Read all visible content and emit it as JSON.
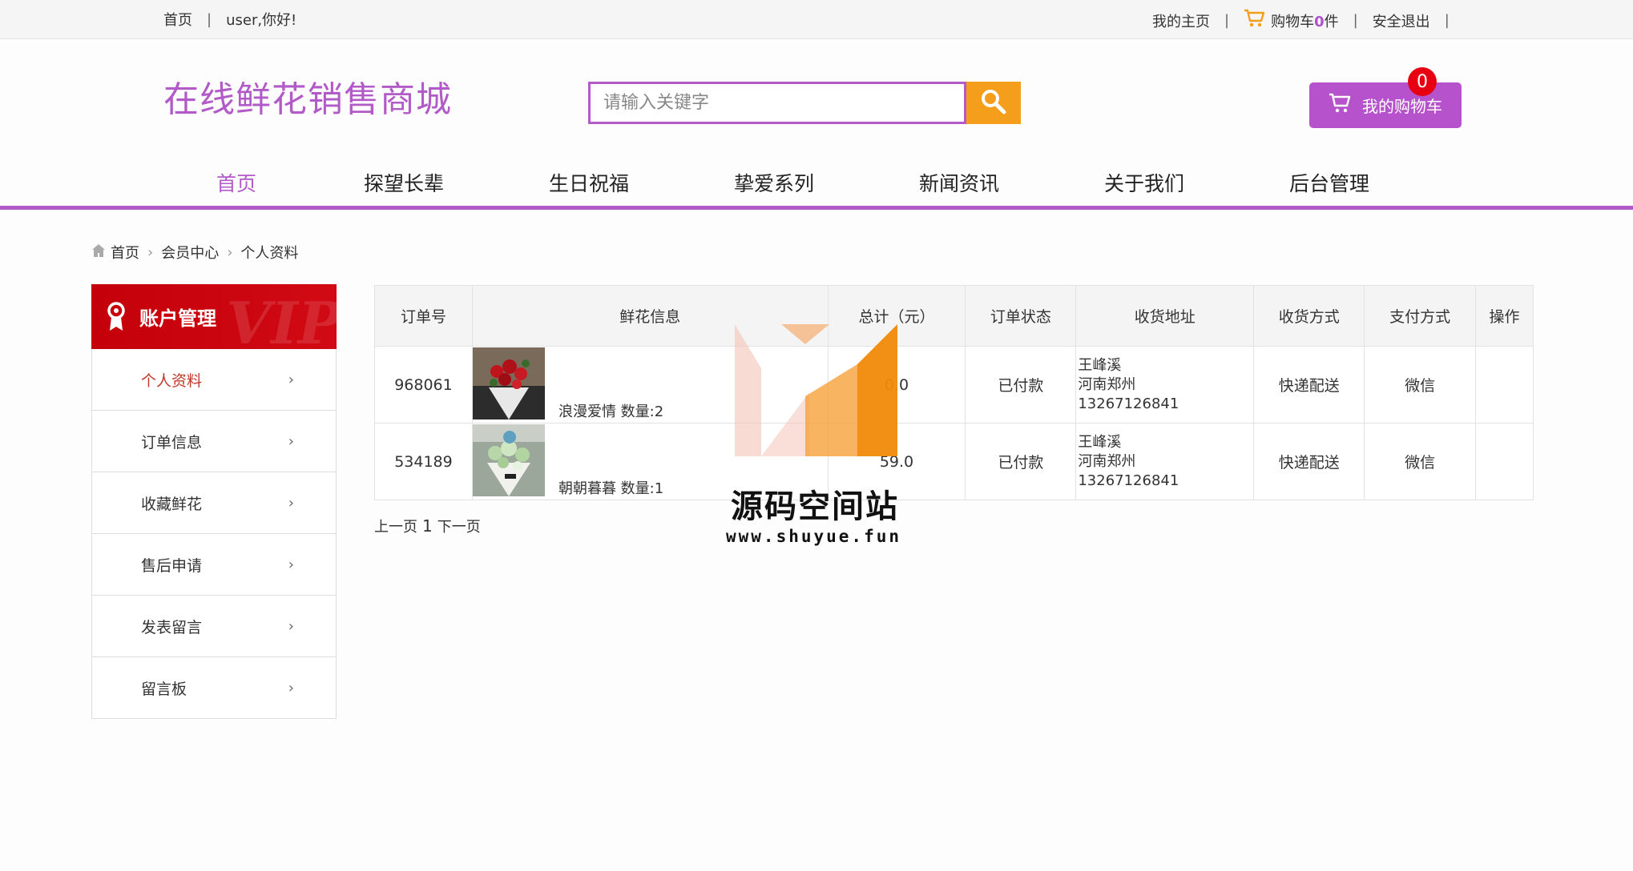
{
  "topbar": {
    "home_link": "首页",
    "greeting": "user,你好!",
    "my_home": "我的主页",
    "cart_label": "购物车",
    "cart_count": "0",
    "cart_unit": "件",
    "logout": "安全退出"
  },
  "header": {
    "logo": "在线鲜花销售商城",
    "search_placeholder": "请输入关键字",
    "cart_button": "我的购物车",
    "cart_badge": "0",
    "accent_color": "#b25ac7",
    "search_button_color": "#f49e1c"
  },
  "nav": {
    "items": [
      {
        "label": "首页",
        "active": true
      },
      {
        "label": "探望长辈"
      },
      {
        "label": "生日祝福"
      },
      {
        "label": "挚爱系列"
      },
      {
        "label": "新闻资讯"
      },
      {
        "label": "关于我们"
      },
      {
        "label": "后台管理"
      }
    ]
  },
  "breadcrumb": [
    "首页",
    "会员中心",
    "个人资料"
  ],
  "sidebar": {
    "title": "账户管理",
    "bg_text": "VIP",
    "items": [
      {
        "label": "个人资料",
        "active": true
      },
      {
        "label": "订单信息"
      },
      {
        "label": "收藏鲜花"
      },
      {
        "label": "售后申请"
      },
      {
        "label": "发表留言"
      },
      {
        "label": "留言板"
      }
    ]
  },
  "orders": {
    "columns": [
      "订单号",
      "鲜花信息",
      "总计（元）",
      "订单状态",
      "收货地址",
      "收货方式",
      "支付方式",
      "操作"
    ],
    "rows": [
      {
        "id": "968061",
        "flower": "浪漫爱情 数量:2",
        "image": "red-rose-bouquet",
        "total": "0.0",
        "status": "已付款",
        "address_name": "王峰溪",
        "address_city": "河南郑州",
        "address_phone": "13267126841",
        "delivery": "快递配送",
        "payment": "微信",
        "action": ""
      },
      {
        "id": "534189",
        "flower": "朝朝暮暮 数量:1",
        "image": "green-white-bouquet",
        "total": "59.0",
        "status": "已付款",
        "address_name": "王峰溪",
        "address_city": "河南郑州",
        "address_phone": "13267126841",
        "delivery": "快递配送",
        "payment": "微信",
        "action": ""
      }
    ]
  },
  "pager": {
    "prev": "上一页",
    "page": "1",
    "next": "下一页"
  },
  "watermark": {
    "title": "源码空间站",
    "url": "www.shuyue.fun"
  }
}
